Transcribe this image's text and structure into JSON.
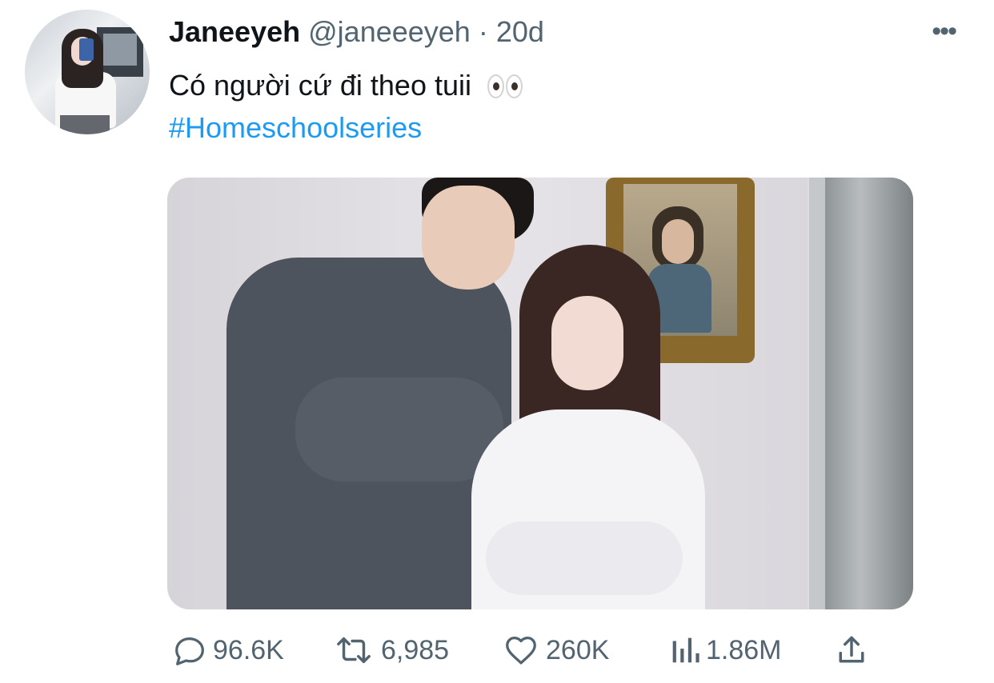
{
  "tweet": {
    "author_name": "Janeeyeh",
    "author_handle": "@janeeeyeh",
    "separator": "·",
    "time": "20d",
    "text": "Có người cứ đi theo tuii",
    "emoji": "eyes-emoji",
    "hashtag": "#Homeschoolseries",
    "more_icon": "more-icon"
  },
  "media": {
    "type": "photo",
    "description_icon": "tweet-photo"
  },
  "actions": {
    "reply_count": "96.6K",
    "retweet_count": "6,985",
    "like_count": "260K",
    "views_count": "1.86M",
    "icons": [
      "reply-icon",
      "retweet-icon",
      "like-icon",
      "views-icon",
      "share-icon"
    ]
  },
  "colors": {
    "link": "#1d9bf0",
    "secondary": "#536471",
    "primary": "#0f1419"
  }
}
